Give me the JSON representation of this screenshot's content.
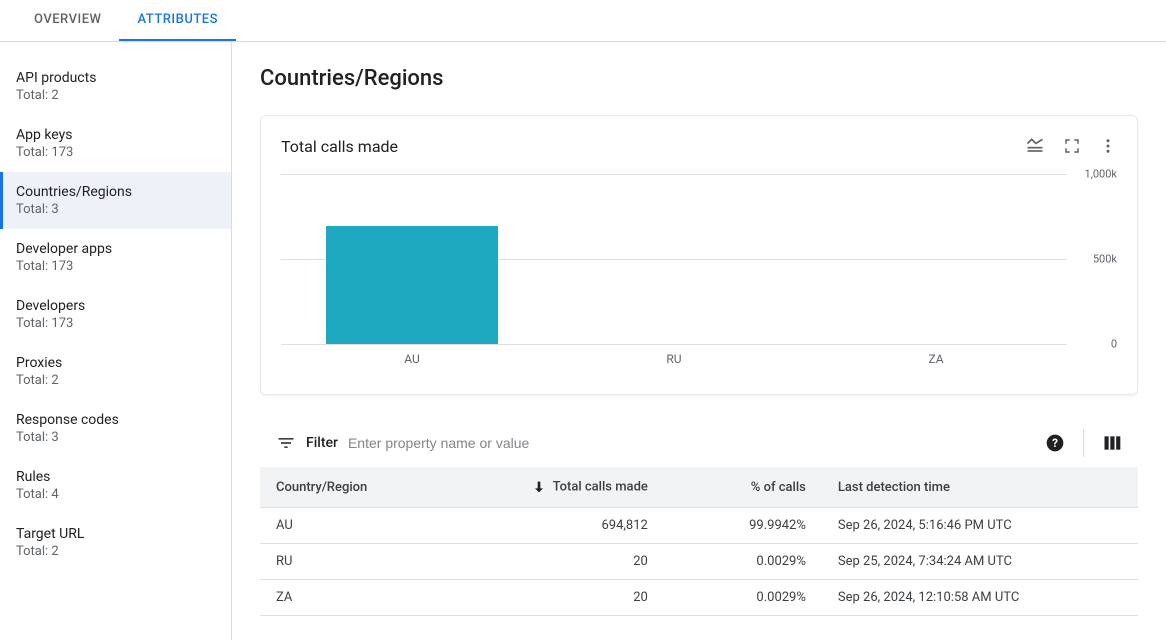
{
  "tabs": {
    "overview": "OVERVIEW",
    "attributes": "ATTRIBUTES"
  },
  "sidebar": {
    "total_prefix": "Total: ",
    "items": [
      {
        "label": "API products",
        "total": "2",
        "selected": false
      },
      {
        "label": "App keys",
        "total": "173",
        "selected": false
      },
      {
        "label": "Countries/Regions",
        "total": "3",
        "selected": true
      },
      {
        "label": "Developer apps",
        "total": "173",
        "selected": false
      },
      {
        "label": "Developers",
        "total": "173",
        "selected": false
      },
      {
        "label": "Proxies",
        "total": "2",
        "selected": false
      },
      {
        "label": "Response codes",
        "total": "3",
        "selected": false
      },
      {
        "label": "Rules",
        "total": "4",
        "selected": false
      },
      {
        "label": "Target URL",
        "total": "2",
        "selected": false
      }
    ]
  },
  "page": {
    "title": "Countries/Regions"
  },
  "chart": {
    "title": "Total calls made",
    "y_ticks": [
      "1,000k",
      "500k",
      "0"
    ]
  },
  "chart_data": {
    "type": "bar",
    "categories": [
      "AU",
      "RU",
      "ZA"
    ],
    "values": [
      694812,
      20,
      20
    ],
    "title": "Total calls made",
    "xlabel": "",
    "ylabel": "",
    "ylim": [
      0,
      1000000
    ]
  },
  "filter": {
    "label": "Filter",
    "placeholder": "Enter property name or value"
  },
  "table": {
    "columns": {
      "country": "Country/Region",
      "calls": "Total calls made",
      "pct": "% of calls",
      "last": "Last detection time"
    },
    "rows": [
      {
        "country": "AU",
        "calls": "694,812",
        "pct": "99.9942%",
        "last": "Sep 26, 2024, 5:16:46 PM UTC"
      },
      {
        "country": "RU",
        "calls": "20",
        "pct": "0.0029%",
        "last": "Sep 25, 2024, 7:34:24 AM UTC"
      },
      {
        "country": "ZA",
        "calls": "20",
        "pct": "0.0029%",
        "last": "Sep 26, 2024, 12:10:58 AM UTC"
      }
    ]
  }
}
